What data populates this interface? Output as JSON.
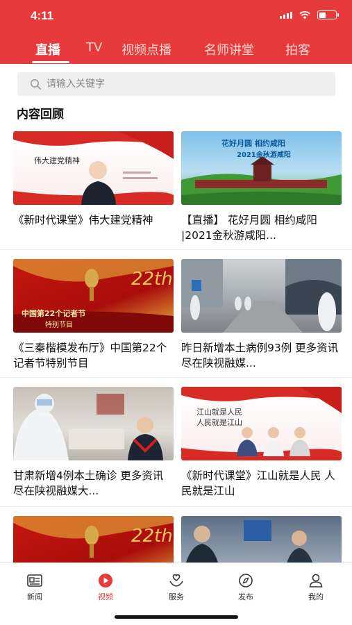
{
  "status_bar": {
    "time": "4:11"
  },
  "tabs": [
    {
      "label": "直播",
      "active": true
    },
    {
      "label": "TV",
      "active": false
    },
    {
      "label": "视频点播",
      "active": false
    },
    {
      "label": "名师讲堂",
      "active": false
    },
    {
      "label": "拍客",
      "active": false
    }
  ],
  "search": {
    "placeholder": "请输入关键字"
  },
  "section_title": "内容回顾",
  "cards": [
    {
      "title": "《新时代课堂》伟大建党精神",
      "thumb_text": "伟大建党精神"
    },
    {
      "title": "【直播】 花好月圆 相约咸阳 |2021金秋游咸阳...",
      "thumb_text": "花好月圆 相约咸阳",
      "thumb_text2": "2021金秋游咸阳"
    },
    {
      "title": "《三秦楷模发布厅》中国第22个记者节特别节目",
      "thumb_text": "中国第22个记者节",
      "thumb_text2": "特别节目",
      "thumb_badge": "22th"
    },
    {
      "title": "昨日新增本土病例93例 更多资讯尽在陕视融媒..."
    },
    {
      "title": "甘肃新增4例本土确诊 更多资讯尽在陕视融媒大..."
    },
    {
      "title": "《新时代课堂》江山就是人民 人民就是江山",
      "thumb_text": "江山就是人民",
      "thumb_text2": "人民就是江山"
    },
    {
      "title": "",
      "thumb_badge": "22th"
    },
    {
      "title": ""
    }
  ],
  "nav": [
    {
      "label": "新闻",
      "icon": "newspaper-icon",
      "active": false
    },
    {
      "label": "视频",
      "icon": "play-icon",
      "active": true
    },
    {
      "label": "服务",
      "icon": "heart-hand-icon",
      "active": false
    },
    {
      "label": "发布",
      "icon": "compass-icon",
      "active": false
    },
    {
      "label": "我的",
      "icon": "user-icon",
      "active": false
    }
  ],
  "colors": {
    "brand": "#e63a3c"
  }
}
